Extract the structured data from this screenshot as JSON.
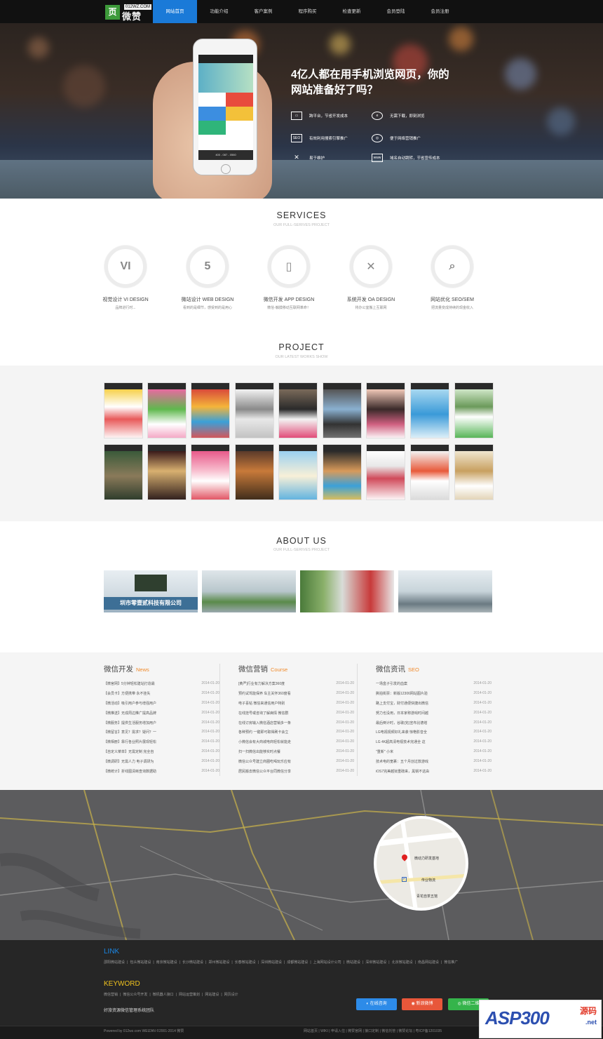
{
  "logo": {
    "mark": "页",
    "text": "微赞",
    "domain": "012WZ.COM"
  },
  "nav": [
    "网站首页",
    "功能介绍",
    "客户案例",
    "程序购买",
    "检查更新",
    "会员登陆",
    "会员注册"
  ],
  "hero": {
    "title": "4亿人都在用手机浏览网页，你的网站准备好了吗？",
    "phone_footer": "400 - 087 - 0560",
    "features": [
      {
        "icon": "monitor-icon",
        "glyph": "▭",
        "text": "跨平台，节省开发成本"
      },
      {
        "icon": "ie-icon",
        "glyph": "e",
        "text": "无需下载，即刻浏览"
      },
      {
        "icon": "seo-icon",
        "glyph": "SEO",
        "text": "有效利用搜索引擎推广"
      },
      {
        "icon": "target-icon",
        "glyph": "◎",
        "text": "便于网络营销推广"
      },
      {
        "icon": "tools-icon",
        "glyph": "✕",
        "text": "易于维护"
      },
      {
        "icon": "www-icon",
        "glyph": "www",
        "text": "域名自动跳转，节省宣传成本"
      }
    ]
  },
  "services": {
    "title": "SERVICES",
    "subtitle": "OUR FULL-SERIVES PROJECT",
    "items": [
      {
        "glyph": "VI",
        "name": "视觉设计 VI DESIGN",
        "desc": "品牌进行时..."
      },
      {
        "glyph": "5",
        "name": "微站设计 WEB DESIGN",
        "desc": "看到的是细节，感受到的是用心"
      },
      {
        "glyph": "▯",
        "name": "微信开发 APP DESIGN",
        "desc": "微信-触摸移动互联网革命！"
      },
      {
        "glyph": "✕",
        "name": "系统开发 OA DESIGN",
        "desc": "将办公室搬上互联网"
      },
      {
        "glyph": "⌕",
        "name": "网站优化 SEO/SEM",
        "desc": "把流量变成持续的现金收入"
      }
    ]
  },
  "project": {
    "title": "PROJECT",
    "subtitle": "OUR LATEST WORKS SHOW"
  },
  "about": {
    "title": "ABOUT US",
    "subtitle": "OUR FULL-SERIVES PROJECT",
    "sign": "圳市零壹贰科技有限公司"
  },
  "news": [
    {
      "title": "微信开发",
      "tag": "News",
      "items": [
        [
          "【微官网】5分钟轻松建站打造最",
          "2014-01-20"
        ],
        [
          "【会员卡】方便携带 永不挂失",
          "2014-01-20"
        ],
        [
          "【微活动】吸引用户参与增强用户",
          "2014-01-20"
        ],
        [
          "【微推送】无成周边推广提高品牌",
          "2014-01-20"
        ],
        [
          "【微服务】提供生活服务增加用户",
          "2014-01-20"
        ],
        [
          "【微留言】意见？需求？疑问？一",
          "2014-01-20"
        ],
        [
          "【微相册】靠行各业照片展现轻松",
          "2014-01-20"
        ],
        [
          "【自定义菜单】无需定制 完全自",
          "2014-01-20"
        ],
        [
          "【微调研】无需人力 电子调研为",
          "2014-01-20"
        ],
        [
          "【微统计】折线图清晰查询数据助",
          "2014-01-20"
        ]
      ]
    },
    {
      "title": "微信营销",
      "tag": "Course",
      "items": [
        [
          "[黄严]行业有力解决方案360度",
          "2014-01-20"
        ],
        [
          "预约试驾能保养 车主关怀360度看",
          "2014-01-20"
        ],
        [
          "电子喜帖 微信来通信用户特别",
          "2014-01-20"
        ],
        [
          "在线挂号或咨询了解病情 微信群",
          "2014-01-20"
        ],
        [
          "在线订房输入微信酒店营销多一条",
          "2014-01-20"
        ],
        [
          "各种预约 一键即可取得刷卡会立",
          "2014-01-20"
        ],
        [
          "小微信会有大商城电商轻松就能走",
          "2014-01-20"
        ],
        [
          "扫一扫微信出能够实时点餐",
          "2014-01-20"
        ],
        [
          "微信公众号建立商圈吃喝玩乐应有",
          "2014-01-20"
        ],
        [
          "居民搬去微信公众平台同微信分享",
          "2014-01-20"
        ]
      ]
    },
    {
      "title": "微信资讯",
      "tag": "SEO",
      "items": [
        [
          "一场盒子引发的血案",
          "2014-01-20"
        ],
        [
          "撕拍街票：新版12306网站图片验",
          "2014-01-20"
        ],
        [
          "路上支付宝，财付通便快捷出微信",
          "2014-01-20"
        ],
        [
          "努力也没用，日本家称游戏时间越",
          "2014-01-20"
        ],
        [
          "最后倒计时，谷歌(完)宣布比德塔",
          "2014-01-20"
        ],
        [
          "LG电视视频好礼来袭 惊艳影音全",
          "2014-01-20"
        ],
        [
          "LG 4K超高清电视技术完通全 这",
          "2014-01-20"
        ],
        [
          "\"重新\" 小米",
          "2014-01-20"
        ],
        [
          "技术电的宽裹：五个月创过款游戏",
          "2014-01-20"
        ],
        [
          "iOS7完美越狱重磅来，黑锅不这由",
          "2014-01-20"
        ]
      ]
    }
  ],
  "map": {
    "place": "微动力研发基地",
    "stop": "传业物流",
    "shop": "青花自茶五馆"
  },
  "footer": {
    "link_title": "LINK",
    "links": [
      "邵阳微站建设",
      "包头微站建设",
      "南京微站建设",
      "长沙微站建设",
      "郑州微站建设",
      "长春微站建设",
      "深圳微站建设",
      "成都微站建设",
      "上海网站设计公司",
      "微站建设",
      "深圳微站建设",
      "北京微站建设",
      "南昌网站建设",
      "微信推广"
    ],
    "keyword_title": "KEYWORD",
    "keywords": [
      "微信营销",
      "微信公众号开发",
      "微机器人接口",
      "网站运营策划",
      "网站建设",
      "网页设计"
    ],
    "team": "好旅资源微信管理系统团队",
    "btn_chat": "在线咨询",
    "btn_weibo": "新浪微博",
    "btn_wechat": "微信二维",
    "copyright": "Powered by 012wz.com WEIZAN ©2001-2014 微赞",
    "bottom_links": "网站首页 | WIKI | 申请入住 | 微赞官网 | 接口定制 | 微信托管 | 微赞论坛 | 粤ICP备1201035",
    "colors": {
      "link": "#1a87e6",
      "keyword": "#f0c21e",
      "chat": "#2d8be8",
      "weibo": "#e8573a",
      "wechat": "#35b44b"
    }
  },
  "watermark": {
    "brand": "ASP300",
    "label": "源码",
    "site": ".net"
  }
}
